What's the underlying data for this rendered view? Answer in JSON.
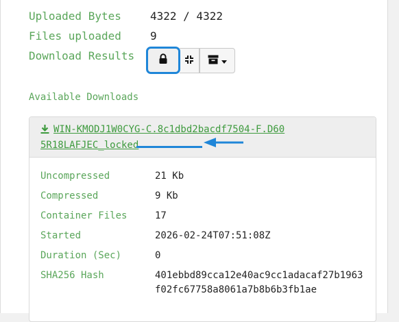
{
  "summary": {
    "uploaded_bytes_label": "Uploaded Bytes",
    "uploaded_bytes_value": "4322 / 4322",
    "files_uploaded_label": "Files uploaded",
    "files_uploaded_value": "9",
    "download_results_label": "Download Results"
  },
  "toolbar": {
    "lock_icon": "lock-icon",
    "compress_icon": "compress-icon",
    "archive_icon": "archive-icon",
    "dropdown_icon": "caret-down-icon"
  },
  "available_downloads_title": "Available Downloads",
  "download": {
    "link_text": "WIN-KMODJ1W0CYG-C.8c1dbd2bacdf7504-F.D605R18LAFJEC_locked",
    "details": [
      {
        "label": "Uncompressed",
        "value": "21 Kb"
      },
      {
        "label": "Compressed",
        "value": "9 Kb"
      },
      {
        "label": "Container Files",
        "value": "17"
      },
      {
        "label": "Started",
        "value": "2026-02-24T07:51:08Z"
      },
      {
        "label": "Duration (Sec)",
        "value": "0"
      },
      {
        "label": "SHA256 Hash",
        "value": "401ebbd89cca12e40ac9cc1adacaf27b1963f02fc67758a8061a7b8b6b3fb1ae"
      }
    ]
  },
  "colors": {
    "label_green": "#5aa65a",
    "highlight_blue": "#1f86d8"
  }
}
